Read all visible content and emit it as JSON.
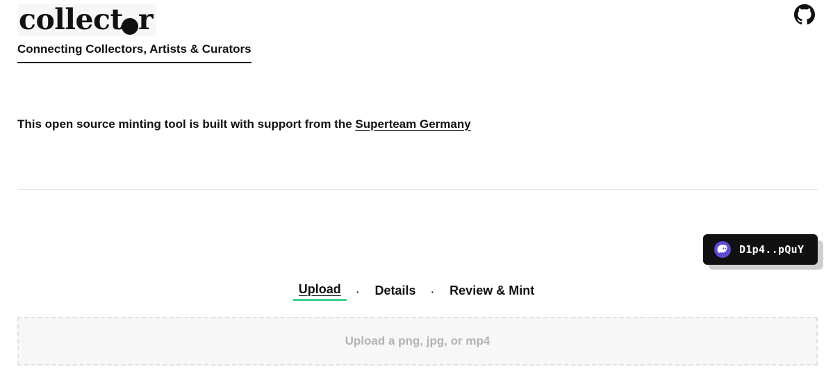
{
  "header": {
    "logo_text_main": "collect",
    "logo_text_end": "r",
    "tagline": "Connecting Collectors, Artists & Curators"
  },
  "support": {
    "text": "This open source minting tool is built with support from the ",
    "link": "Superteam Germany"
  },
  "wallet": {
    "address": "D1p4..pQuY",
    "icon": "ghost-icon",
    "color": "#5b4bd6"
  },
  "steps": {
    "items": [
      "Upload",
      "Details",
      "Review & Mint"
    ],
    "separator": "·",
    "active_color": "#3ecf8e"
  },
  "upload": {
    "placeholder": "Upload a png, jpg, or mp4"
  },
  "icons": {
    "github": "github-icon"
  }
}
